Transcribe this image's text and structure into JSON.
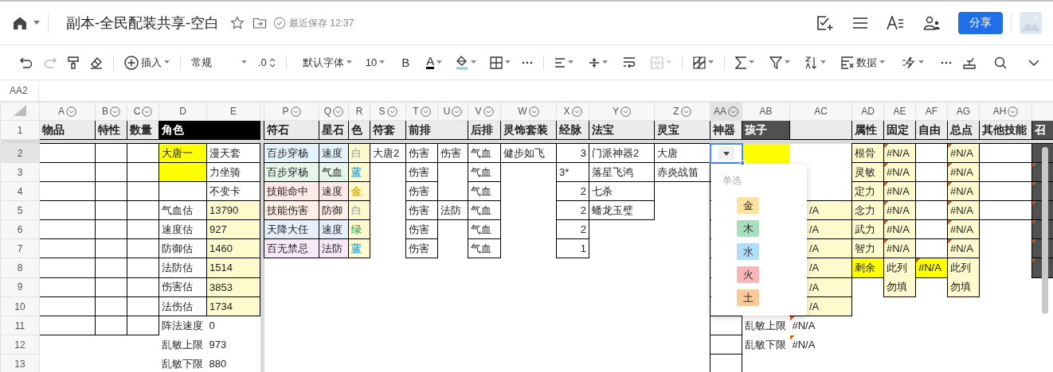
{
  "header": {
    "title": "副本-全民配装共享-空白",
    "save_status": "最近保存 12:37",
    "share_button": "分享"
  },
  "toolbar": {
    "insert": "插入",
    "number_format": "常规",
    "decimals": ".0",
    "font": "默认字体",
    "font_size": "10",
    "bold": "B",
    "font_color": "A",
    "data_menu": "数据",
    "redo_enabled": false,
    "merge_enabled": false
  },
  "formula_bar": {
    "cell_ref": "AA2"
  },
  "sheet": {
    "columns": [
      {
        "label": "A",
        "filter": true,
        "selected": false
      },
      {
        "label": "B",
        "filter": true,
        "selected": false
      },
      {
        "label": "C",
        "filter": true,
        "selected": false
      },
      {
        "label": "D",
        "filter": false,
        "selected": false
      },
      {
        "label": "E",
        "filter": false,
        "selected": false
      },
      {
        "label": "P",
        "filter": true,
        "selected": false
      },
      {
        "label": "Q",
        "filter": true,
        "selected": false
      },
      {
        "label": "R",
        "filter": false,
        "selected": false
      },
      {
        "label": "S",
        "filter": true,
        "selected": false
      },
      {
        "label": "T",
        "filter": true,
        "selected": false
      },
      {
        "label": "U",
        "filter": true,
        "selected": false
      },
      {
        "label": "V",
        "filter": true,
        "selected": false
      },
      {
        "label": "W",
        "filter": true,
        "selected": false
      },
      {
        "label": "X",
        "filter": true,
        "selected": false
      },
      {
        "label": "Y",
        "filter": true,
        "selected": false
      },
      {
        "label": "Z",
        "filter": true,
        "selected": false
      },
      {
        "label": "AA",
        "filter": true,
        "selected": true
      },
      {
        "label": "AB",
        "filter": false,
        "selected": false
      },
      {
        "label": "AC",
        "filter": false,
        "selected": false
      },
      {
        "label": "AD",
        "filter": false,
        "selected": false
      },
      {
        "label": "AE",
        "filter": false,
        "selected": false
      },
      {
        "label": "AF",
        "filter": false,
        "selected": false
      },
      {
        "label": "AG",
        "filter": false,
        "selected": false
      },
      {
        "label": "AH",
        "filter": true,
        "selected": false
      },
      {
        "filter": false,
        "selected": false
      }
    ],
    "rows": [
      {
        "label": "1",
        "kind": "header",
        "selected": false,
        "cells": [
          {
            "text": "物品",
            "boxed": true
          },
          {
            "text": "特性",
            "boxed": true
          },
          {
            "text": "数量",
            "boxed": true
          },
          {
            "text": "角色",
            "boxed": true,
            "kind": "title",
            "color": "#000000",
            "colspan": 2
          },
          {
            "text": "符石",
            "boxed": true
          },
          {
            "text": "星石",
            "boxed": true
          },
          {
            "text": "色",
            "boxed": true
          },
          {
            "text": "符套",
            "boxed": true
          },
          {
            "text": "前排",
            "boxed": true,
            "colspan": 2
          },
          {
            "text": "后排",
            "boxed": true
          },
          {
            "text": "灵饰套装",
            "boxed": true
          },
          {
            "text": "经脉",
            "boxed": true
          },
          {
            "text": "法宝",
            "boxed": true
          },
          {
            "text": "灵宝",
            "boxed": true
          },
          {
            "text": "神器",
            "boxed": true
          },
          {
            "text": "孩子",
            "boxed": true,
            "kind": "title",
            "color": "#505050"
          },
          {
            "boxed": true
          },
          {
            "text": "属性",
            "boxed": true
          },
          {
            "text": "固定",
            "boxed": true
          },
          {
            "text": "自由",
            "boxed": true
          },
          {
            "text": "总点",
            "boxed": true
          },
          {
            "text": "其他技能",
            "boxed": true
          },
          {
            "text": "召",
            "boxed": true,
            "kind": "title",
            "color": "#505050"
          }
        ]
      },
      {
        "label": "2",
        "kind": "data",
        "selected": true,
        "cells": [
          {
            "boxed": true
          },
          {
            "boxed": true
          },
          {
            "boxed": true
          },
          {
            "text": "大唐一",
            "boxed": true,
            "color": "#ffff00"
          },
          {
            "text": "漫天套",
            "boxed": true
          },
          {
            "text": "百步穿杨",
            "boxed": true,
            "color": "#e3f2fb"
          },
          {
            "text": "速度",
            "boxed": true,
            "color": "#e3f2fb"
          },
          {
            "text": "白",
            "boxed": true,
            "kind": "swatch",
            "color": "#b4b4b4"
          },
          {
            "text": "大唐2",
            "boxed": true
          },
          {
            "text": "伤害",
            "boxed": true
          },
          {
            "text": "伤害",
            "boxed": true
          },
          {
            "text": "气血",
            "boxed": true
          },
          {
            "text": "健步如飞",
            "boxed": true
          },
          {
            "text": "3",
            "boxed": true,
            "kind": "number"
          },
          {
            "text": "门派神器2",
            "boxed": true
          },
          {
            "text": "大唐",
            "boxed": true
          },
          {
            "boxed": true,
            "kind": "dropdown"
          },
          {
            "color": "#ffff00"
          },
          {},
          {
            "text": "根骨",
            "boxed": true,
            "color": "#fffacd"
          },
          {
            "text": "#N/A",
            "boxed": true,
            "color": "#fffacd",
            "flag": true
          },
          {
            "boxed": true
          },
          {
            "text": "#N/A",
            "boxed": true,
            "color": "#fffacd",
            "flag": true
          },
          {
            "boxed": true
          },
          {
            "boxed": true,
            "color": "#505050"
          }
        ]
      },
      {
        "label": "3",
        "kind": "data",
        "selected": false,
        "cells": [
          {
            "boxed": true
          },
          {
            "boxed": true
          },
          {
            "boxed": true
          },
          {
            "boxed": true,
            "color": "#ffff00"
          },
          {
            "text": "力坐骑",
            "boxed": true
          },
          {
            "text": "百步穿杨",
            "boxed": true,
            "color": "#e5f6ec"
          },
          {
            "text": "气血",
            "boxed": true,
            "color": "#e5f6ec"
          },
          {
            "text": "蓝",
            "boxed": true,
            "kind": "swatch",
            "color": "#3aaee8"
          },
          {},
          {
            "text": "伤害",
            "boxed": true
          },
          {},
          {
            "text": "气血",
            "boxed": true
          },
          {},
          {
            "text": "3*",
            "boxed": true
          },
          {
            "text": "落星飞鸿",
            "boxed": true
          },
          {
            "text": "赤炎战笛",
            "boxed": true
          },
          {
            "boxed": true
          },
          {},
          {},
          {
            "text": "灵敏",
            "boxed": true,
            "color": "#fffacd"
          },
          {
            "text": "#N/A",
            "boxed": true,
            "color": "#fffacd",
            "flag": true
          },
          {
            "boxed": true
          },
          {
            "text": "#N/A",
            "boxed": true,
            "color": "#fffacd",
            "flag": true
          },
          {
            "boxed": true
          },
          {
            "boxed": true,
            "color": "#505050",
            "flag": true
          }
        ]
      },
      {
        "label": "4",
        "kind": "data",
        "selected": false,
        "cells": [
          {
            "boxed": true
          },
          {
            "boxed": true
          },
          {
            "boxed": true
          },
          {
            "boxed": true
          },
          {
            "text": "不变卡",
            "boxed": true
          },
          {
            "text": "技能命中",
            "boxed": true,
            "color": "#fde9e7"
          },
          {
            "text": "速度",
            "boxed": true,
            "color": "#fde9e7"
          },
          {
            "text": "金",
            "boxed": true,
            "kind": "swatch",
            "color": "#e6b400"
          },
          {},
          {
            "text": "伤害",
            "boxed": true
          },
          {},
          {
            "text": "气血",
            "boxed": true
          },
          {},
          {
            "text": "2",
            "boxed": true,
            "kind": "number"
          },
          {
            "text": "七杀",
            "boxed": true
          },
          {},
          {
            "boxed": true
          },
          {},
          {},
          {
            "text": "定力",
            "boxed": true,
            "color": "#fffacd"
          },
          {
            "text": "#N/A",
            "boxed": true,
            "color": "#fffacd",
            "flag": true
          },
          {
            "boxed": true
          },
          {
            "text": "#N/A",
            "boxed": true,
            "color": "#fffacd",
            "flag": true
          },
          {
            "boxed": true
          },
          {
            "boxed": true,
            "color": "#505050",
            "flag": true
          }
        ]
      },
      {
        "label": "5",
        "kind": "data",
        "selected": false,
        "cells": [
          {
            "boxed": true
          },
          {
            "boxed": true
          },
          {
            "boxed": true
          },
          {
            "text": "气血估",
            "boxed": true
          },
          {
            "text": "13790",
            "boxed": true,
            "color": "#fffacd"
          },
          {
            "text": "技能伤害",
            "boxed": true,
            "color": "#fdefe7"
          },
          {
            "text": "防御",
            "boxed": true,
            "color": "#fdefe7"
          },
          {
            "text": "白",
            "boxed": true,
            "kind": "swatch",
            "color": "#b4b4b4"
          },
          {},
          {
            "text": "伤害",
            "boxed": true
          },
          {
            "text": "法防",
            "boxed": true
          },
          {
            "text": "气血",
            "boxed": true
          },
          {},
          {
            "text": "2",
            "boxed": true,
            "kind": "number"
          },
          {
            "text": "蟠龙玉璧",
            "boxed": true
          },
          {},
          {
            "boxed": true
          },
          {},
          {
            "text": "/A",
            "boxed": true,
            "color": "#fffacd",
            "kind": "clipped"
          },
          {
            "text": "念力",
            "boxed": true,
            "color": "#fffacd"
          },
          {
            "text": "#N/A",
            "boxed": true,
            "color": "#fffacd",
            "flag": true
          },
          {
            "boxed": true
          },
          {
            "text": "#N/A",
            "boxed": true,
            "color": "#fffacd",
            "flag": true
          },
          {
            "boxed": true
          },
          {
            "boxed": true,
            "color": "#505050",
            "flag": true
          }
        ]
      },
      {
        "label": "6",
        "kind": "data",
        "selected": false,
        "cells": [
          {
            "boxed": true
          },
          {
            "boxed": true
          },
          {
            "boxed": true
          },
          {
            "text": "速度估",
            "boxed": true
          },
          {
            "text": "927",
            "boxed": true,
            "color": "#fffacd"
          },
          {
            "text": "天降大任",
            "boxed": true,
            "color": "#e4effb"
          },
          {
            "text": "速度",
            "boxed": true,
            "color": "#e4effb"
          },
          {
            "text": "绿",
            "boxed": true,
            "kind": "swatch",
            "color": "#5ac27a"
          },
          {},
          {
            "text": "伤害",
            "boxed": true
          },
          {},
          {
            "text": "气血",
            "boxed": true
          },
          {},
          {
            "text": "2",
            "boxed": true,
            "kind": "number"
          },
          {},
          {},
          {
            "boxed": true
          },
          {},
          {
            "text": "/A",
            "boxed": true,
            "color": "#fffacd",
            "kind": "clipped"
          },
          {
            "text": "武力",
            "boxed": true,
            "color": "#fffacd"
          },
          {
            "text": "#N/A",
            "boxed": true,
            "color": "#fffacd",
            "flag": true
          },
          {
            "boxed": true
          },
          {
            "text": "#N/A",
            "boxed": true,
            "color": "#fffacd",
            "flag": true
          },
          {},
          {
            "boxed": true,
            "color": "#505050",
            "flag": true
          }
        ]
      },
      {
        "label": "7",
        "kind": "data",
        "selected": false,
        "cells": [
          {
            "boxed": true
          },
          {
            "boxed": true
          },
          {
            "boxed": true
          },
          {
            "text": "防御估",
            "boxed": true
          },
          {
            "text": "1460",
            "boxed": true,
            "color": "#fffacd"
          },
          {
            "text": "百无禁忌",
            "boxed": true,
            "color": "#f9e9f8"
          },
          {
            "text": "法防",
            "boxed": true,
            "color": "#f9e9f8"
          },
          {
            "text": "蓝",
            "boxed": true,
            "kind": "swatch",
            "color": "#3aaee8"
          },
          {},
          {
            "text": "伤害",
            "boxed": true
          },
          {},
          {
            "text": "气血",
            "boxed": true
          },
          {},
          {
            "text": "1",
            "boxed": true,
            "kind": "number"
          },
          {},
          {},
          {
            "boxed": true
          },
          {},
          {
            "text": "/A",
            "boxed": true,
            "color": "#fffacd",
            "kind": "clipped"
          },
          {
            "text": "智力",
            "boxed": true,
            "color": "#fffacd"
          },
          {
            "text": "#N/A",
            "boxed": true,
            "color": "#fffacd",
            "flag": true
          },
          {
            "boxed": true
          },
          {
            "text": "#N/A",
            "boxed": true,
            "color": "#fffacd",
            "flag": true
          },
          {},
          {
            "boxed": true,
            "color": "#505050",
            "flag": true
          }
        ]
      },
      {
        "label": "8",
        "kind": "data",
        "selected": false,
        "cells": [
          {
            "boxed": true
          },
          {
            "boxed": true
          },
          {
            "boxed": true
          },
          {
            "text": "法防估",
            "boxed": true
          },
          {
            "text": "1514",
            "boxed": true,
            "color": "#fffacd"
          },
          {},
          {},
          {},
          {},
          {},
          {},
          {},
          {},
          {},
          {},
          {},
          {
            "boxed": true
          },
          {},
          {
            "text": "/A",
            "boxed": true,
            "color": "#fffacd",
            "kind": "clipped"
          },
          {
            "text": "剩余",
            "boxed": true,
            "color": "#ffff00"
          },
          {
            "text": "此列勿填",
            "boxed": true,
            "color": "#fffacd",
            "kind": "note",
            "rowspan": 2
          },
          {
            "text": "#N/A",
            "boxed": true,
            "color": "#ffff00",
            "flag": true
          },
          {
            "text": "此列勿填",
            "boxed": true,
            "color": "#fffacd",
            "kind": "note",
            "rowspan": 2
          },
          {},
          {
            "boxed": true,
            "color": "#505050",
            "flag": true
          }
        ]
      },
      {
        "label": "9",
        "kind": "data",
        "selected": false,
        "cells": [
          {
            "boxed": true
          },
          {
            "boxed": true
          },
          {
            "boxed": true
          },
          {
            "text": "伤害估",
            "boxed": true
          },
          {
            "text": "3853",
            "boxed": true,
            "color": "#fffacd"
          },
          {},
          {},
          {},
          {},
          {},
          {},
          {},
          {},
          {},
          {},
          {},
          {
            "boxed": true
          },
          {},
          {
            "text": "/A",
            "boxed": true,
            "color": "#fffacd",
            "kind": "clipped"
          },
          {},
          {},
          {},
          {}
        ]
      },
      {
        "label": "10",
        "kind": "data",
        "selected": false,
        "cells": [
          {
            "boxed": true
          },
          {
            "boxed": true
          },
          {
            "boxed": true
          },
          {
            "text": "法伤估",
            "boxed": true
          },
          {
            "text": "1734",
            "boxed": true,
            "color": "#fffacd"
          },
          {},
          {},
          {},
          {},
          {},
          {},
          {},
          {},
          {},
          {},
          {},
          {
            "boxed": true
          },
          {},
          {
            "text": "/A",
            "boxed": true,
            "color": "#fffacd",
            "kind": "clipped"
          },
          {},
          {},
          {},
          {},
          {},
          {}
        ]
      },
      {
        "label": "11",
        "kind": "data",
        "selected": false,
        "cells": [
          {
            "boxed": true
          },
          {
            "boxed": true
          },
          {
            "boxed": true
          },
          {
            "text": "阵法速度"
          },
          {
            "text": "0"
          },
          {},
          {},
          {},
          {},
          {},
          {},
          {},
          {},
          {},
          {},
          {},
          {
            "boxed": true
          },
          {
            "text": "乱敏上限"
          },
          {
            "text": "#N/A",
            "flag": true
          },
          {},
          {},
          {},
          {},
          {},
          {}
        ]
      },
      {
        "label": "12",
        "kind": "data",
        "selected": false,
        "cells": [
          {},
          {},
          {},
          {
            "text": "乱敏上限"
          },
          {
            "text": "973"
          },
          {},
          {},
          {},
          {},
          {},
          {},
          {},
          {},
          {},
          {},
          {},
          {
            "boxed": true
          },
          {
            "text": "乱敏下限"
          },
          {
            "text": "#N/A",
            "flag": true
          },
          {},
          {},
          {},
          {},
          {},
          {}
        ]
      },
      {
        "label": "13",
        "kind": "data",
        "selected": false,
        "cells": [
          {},
          {},
          {},
          {
            "text": "乱敏下限"
          },
          {
            "text": "880"
          },
          {},
          {},
          {},
          {},
          {},
          {},
          {},
          {},
          {},
          {},
          {},
          {
            "boxed": true
          },
          {},
          {},
          {},
          {},
          {},
          {},
          {},
          {}
        ]
      }
    ]
  },
  "dropdown": {
    "label": "单选",
    "options": [
      {
        "label": "金",
        "color": "#fde2a4"
      },
      {
        "label": "木",
        "color": "#a8dfbf"
      },
      {
        "label": "水",
        "color": "#b1ddf7"
      },
      {
        "label": "火",
        "color": "#f8b6b9"
      },
      {
        "label": "土",
        "color": "#f9c89b"
      }
    ]
  }
}
